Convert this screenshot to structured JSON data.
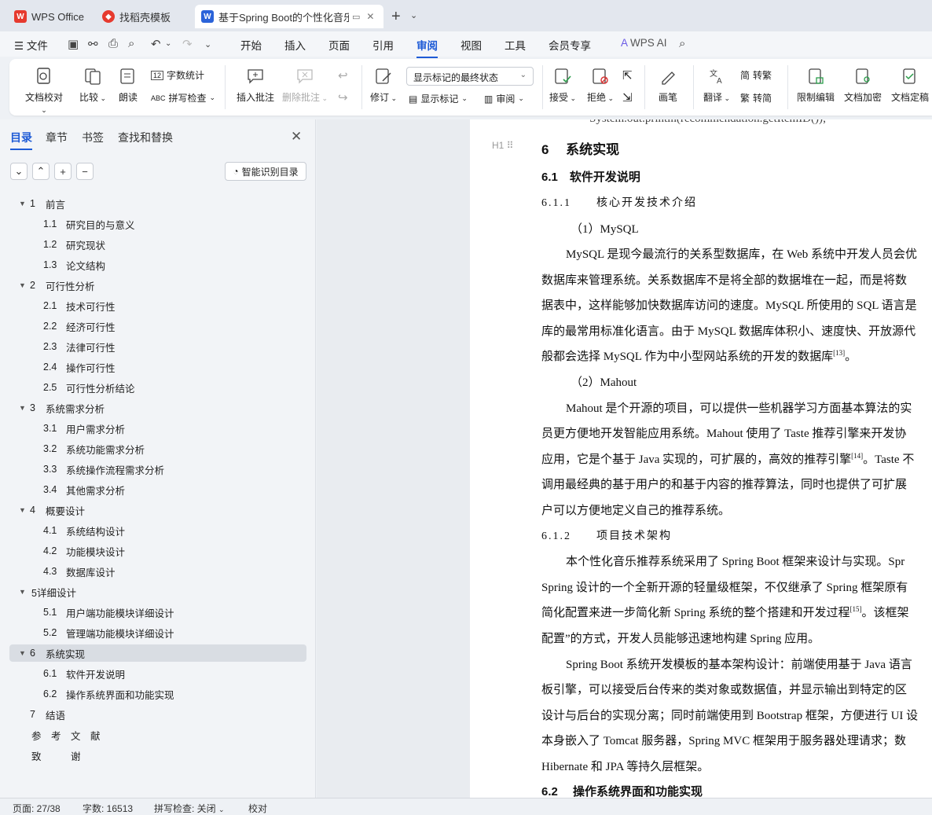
{
  "tabs": [
    {
      "label": "WPS Office"
    },
    {
      "label": "找稻壳模板"
    },
    {
      "label": "基于Spring Boot的个性化音乐"
    }
  ],
  "menu": {
    "file": "文件",
    "items": [
      "开始",
      "插入",
      "页面",
      "引用",
      "审阅",
      "视图",
      "工具",
      "会员专享"
    ],
    "ai": "WPS AI"
  },
  "ribbon": {
    "doc_proof": "文档校对",
    "compare": "比较",
    "read_aloud": "朗读",
    "word_count": "字数统计",
    "spell_check": "拼写检查",
    "insert_comment": "插入批注",
    "delete_comment": "删除批注",
    "revise": "修订",
    "markup_dropdown": "显示标记的最终状态",
    "show_markup": "显示标记",
    "review": "审阅",
    "accept": "接受",
    "reject": "拒绝",
    "pen": "画笔",
    "translate": "翻译",
    "to_traditional": "转繁",
    "to_simplified": "转简",
    "restrict_edit": "限制编辑",
    "doc_encrypt": "文档加密",
    "doc_finalize": "文档定稿"
  },
  "nav": {
    "tabs": [
      "目录",
      "章节",
      "书签",
      "查找和替换"
    ],
    "smart_btn": "智能识别目录",
    "toc": [
      {
        "num": "1",
        "text": "前言"
      },
      {
        "num": "1.1",
        "text": "研究目的与意义"
      },
      {
        "num": "1.2",
        "text": "研究现状"
      },
      {
        "num": "1.3",
        "text": "论文结构"
      },
      {
        "num": "2",
        "text": "可行性分析"
      },
      {
        "num": "2.1",
        "text": "技术可行性"
      },
      {
        "num": "2.2",
        "text": "经济可行性"
      },
      {
        "num": "2.3",
        "text": "法律可行性"
      },
      {
        "num": "2.4",
        "text": "操作可行性"
      },
      {
        "num": "2.5",
        "text": "可行性分析结论"
      },
      {
        "num": "3",
        "text": "系统需求分析"
      },
      {
        "num": "3.1",
        "text": "用户需求分析"
      },
      {
        "num": "3.2",
        "text": "系统功能需求分析"
      },
      {
        "num": "3.3",
        "text": "系统操作流程需求分析"
      },
      {
        "num": "3.4",
        "text": "其他需求分析"
      },
      {
        "num": "4",
        "text": "概要设计"
      },
      {
        "num": "4.1",
        "text": "系统结构设计"
      },
      {
        "num": "4.2",
        "text": "功能模块设计"
      },
      {
        "num": "4.3",
        "text": "数据库设计"
      },
      {
        "num": "",
        "text": "5详细设计"
      },
      {
        "num": "5.1",
        "text": "用户端功能模块详细设计"
      },
      {
        "num": "5.2",
        "text": "管理端功能模块详细设计"
      },
      {
        "num": "6",
        "text": "系统实现"
      },
      {
        "num": "6.1",
        "text": "软件开发说明"
      },
      {
        "num": "6.2",
        "text": "操作系统界面和功能实现"
      },
      {
        "num": "7",
        "text": "结语"
      },
      {
        "num": "",
        "text": "参　考　文　献"
      },
      {
        "num": "",
        "text": "致　　　谢"
      }
    ]
  },
  "doc": {
    "top_cut": "System.out.println(recommendation.getItemID());",
    "h_mark": "H1",
    "lines": [
      "6　 系统实现",
      "6.1　软件开发说明",
      "6.1.1　　核心开发技术介绍",
      "（1）MySQL",
      "MySQL 是现今最流行的关系型数据库，在 Web 系统中开发人员会优",
      "数据库来管理系统。关系数据库不是将全部的数据堆在一起，而是将数",
      "据表中，这样能够加快数据库访问的速度。MySQL 所使用的 SQL 语言是",
      "库的最常用标准化语言。由于 MySQL 数据库体积小、速度快、开放源代",
      "般都会选择 MySQL 作为中小型网站系统的开发的数据库",
      "（2）Mahout",
      "Mahout 是个开源的项目，可以提供一些机器学习方面基本算法的实",
      "员更方便地开发智能应用系统。Mahout 使用了 Taste 推荐引擎来开发协",
      "应用，它是个基于 Java 实现的，可扩展的，高效的推荐引擎",
      "调用最经典的基于用户的和基于内容的推荐算法，同时也提供了可扩展",
      "户可以方便地定义自己的推荐系统。",
      "6.1.2　　项目技术架构",
      "本个性化音乐推荐系统采用了 Spring Boot 框架来设计与实现。Spr",
      "Spring 设计的一个全新开源的轻量级框架，不仅继承了 Spring 框架原有",
      "简化配置来进一步简化新 Spring 系统的整个搭建和开发过程",
      "配置”的方式，开发人员能够迅速地构建 Spring 应用。",
      "Spring Boot 系统开发模板的基本架构设计：前端使用基于 Java 语言",
      "板引擎，可以接受后台传来的类对象或数据值，并显示输出到特定的区",
      "设计与后台的实现分离；同时前端使用到 Bootstrap 框架，方便进行 UI 设",
      "本身嵌入了 Tomcat 服务器，Spring MVC 框架用于服务器处理请求；数",
      "Hibernate 和 JPA 等持久层框架。",
      "6.2　 操作系统界面和功能实现"
    ],
    "refs": {
      "r13": "[13]",
      "r14": "[14]",
      "r15": "[15]"
    },
    "tails": {
      "t8": "。",
      "t12": "。Taste 不",
      "t18": "。该框架"
    }
  },
  "status": {
    "page": "页面: 27/38",
    "words": "字数: 16513",
    "spell": "拼写检查: 关闭",
    "proof": "校对"
  }
}
